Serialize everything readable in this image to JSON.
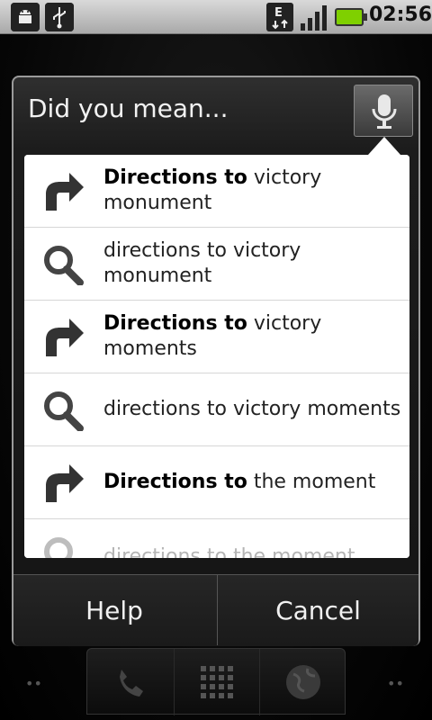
{
  "status_bar": {
    "time": "02:56",
    "data_indicator": "E",
    "icons": [
      "android-debug-icon",
      "usb-icon",
      "data-edge-icon",
      "signal-icon",
      "battery-icon"
    ],
    "battery_color": "#7fd000"
  },
  "dialog": {
    "title": "Did you mean...",
    "mic_icon": "microphone-icon",
    "suggestions": [
      {
        "icon": "directions-arrow-icon",
        "bold": "Directions to",
        "rest": " victory monument"
      },
      {
        "icon": "search-icon",
        "bold": "",
        "rest": "directions to victory monument"
      },
      {
        "icon": "directions-arrow-icon",
        "bold": "Directions to",
        "rest": " victory moments"
      },
      {
        "icon": "search-icon",
        "bold": "",
        "rest": "directions to victory moments"
      },
      {
        "icon": "directions-arrow-icon",
        "bold": "Directions to",
        "rest": " the moment"
      },
      {
        "icon": "search-icon",
        "bold": "",
        "rest": "directions to the moment"
      }
    ],
    "buttons": {
      "help": "Help",
      "cancel": "Cancel"
    }
  },
  "dock": {
    "items": [
      "phone-icon",
      "app-launcher-icon",
      "browser-globe-icon"
    ]
  }
}
